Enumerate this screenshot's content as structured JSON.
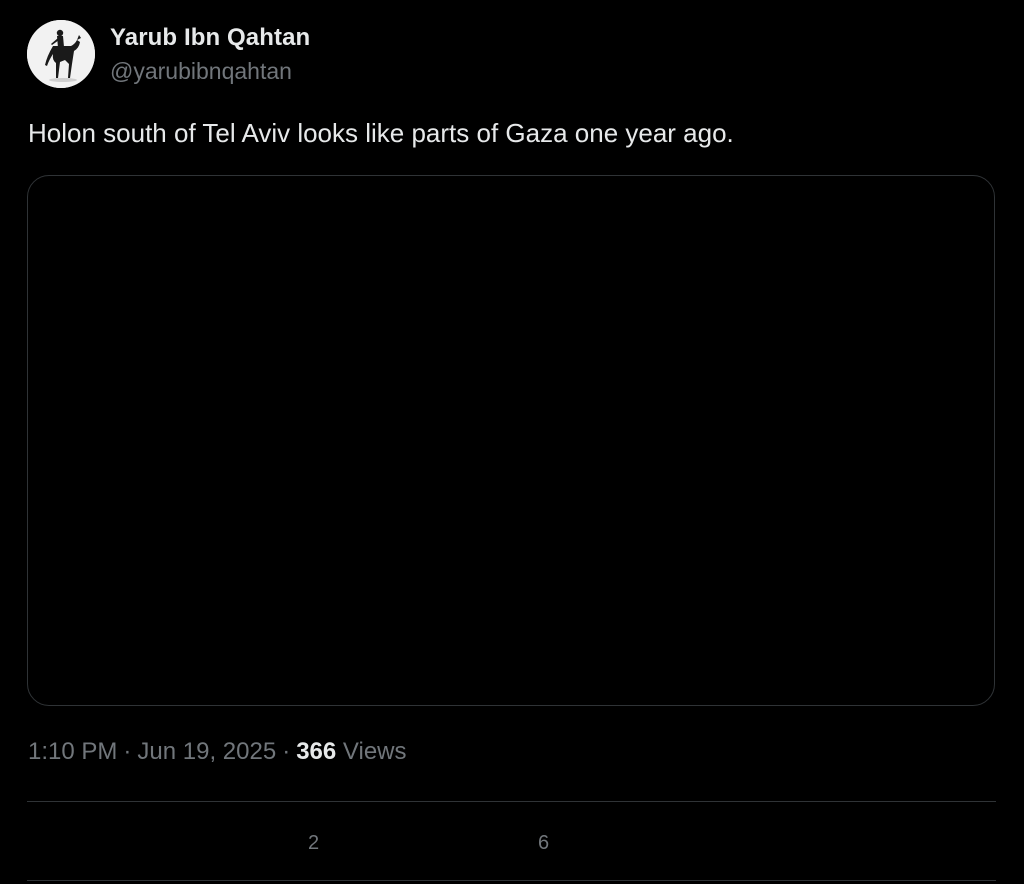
{
  "author": {
    "display_name": "Yarub Ibn Qahtan",
    "handle": "@yarubibnqahtan",
    "avatar_icon": "horse-rider-avatar"
  },
  "tweet": {
    "text": "Holon south of Tel Aviv looks like parts of Gaza one year ago."
  },
  "meta": {
    "time": "1:10 PM",
    "separator": "·",
    "date": "Jun 19, 2025",
    "views_count": "366",
    "views_label": "Views"
  },
  "actions": {
    "reposts_count": "2",
    "likes_count": "6"
  },
  "colors": {
    "background": "#000000",
    "primary_text": "#e7e9ea",
    "secondary_text": "#71767b",
    "border": "#2f3336"
  }
}
